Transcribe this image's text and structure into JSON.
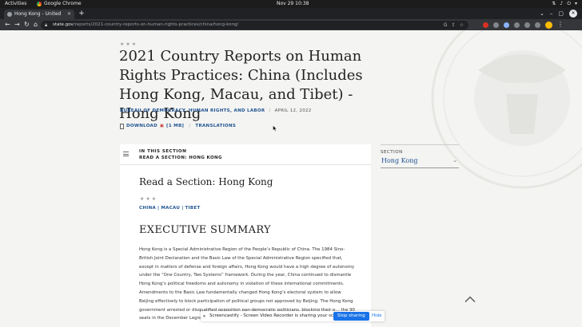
{
  "system": {
    "activities": "Activities",
    "app_name": "Google Chrome",
    "clock": "Nov 29  10:38"
  },
  "browser": {
    "tab_title": "Hong Kong - United State",
    "url_host": "state.gov",
    "url_path": "/reports/2021-country-reports-on-human-rights-practices/china/hong-kong/"
  },
  "page": {
    "header_stars": "★★★",
    "title": "2021 Country Reports on Human Rights Practices: China (Includes Hong Kong, Macau, and Tibet) - Hong Kong",
    "bureau": "BUREAU OF DEMOCRACY, HUMAN RIGHTS, AND LABOR",
    "date": "APRIL 12, 2022",
    "download_label": "DOWNLOAD",
    "download_size": "[1 MB]",
    "translations_label": "TRANSLATIONS"
  },
  "card": {
    "in_this_section": "IN THIS SECTION",
    "read_section": "READ A SECTION: HONG KONG",
    "heading": "Read a Section: Hong Kong",
    "stars": "★★★",
    "links": [
      "CHINA",
      "MACAU",
      "TIBET"
    ],
    "executive_summary": "EXECUTIVE SUMMARY",
    "body": "Hong Kong is a Special Administrative Region of the People’s Republic of China. The 1984 Sino-British Joint Declaration and the Basic Law of the Special Administrative Region specified that, except in matters of defense and foreign affairs, Hong Kong would have a high degree of autonomy under the “One Country, Two Systems” framework. During the year, China continued to dismantle Hong Kong’s political freedoms and autonomy in violation of these international commitments. Amendments to the Basic Law fundamentally changed Hong Kong’s electoral system to allow Beijing effectively to block participation of political groups not approved by Beijing. The Hong Kong government arrested or disqualified opposition pan-democratic politicians, blocking their p… the 90 seats in the December Legislative Council election, which was widely regarded as"
  },
  "section_selector": {
    "label": "SECTION",
    "value": "Hong Kong"
  },
  "screencastify": {
    "message": "Screencastify - Screen Video Recorder is sharing your screen.",
    "stop_label": "Stop sharing",
    "hide_label": "Hide"
  }
}
